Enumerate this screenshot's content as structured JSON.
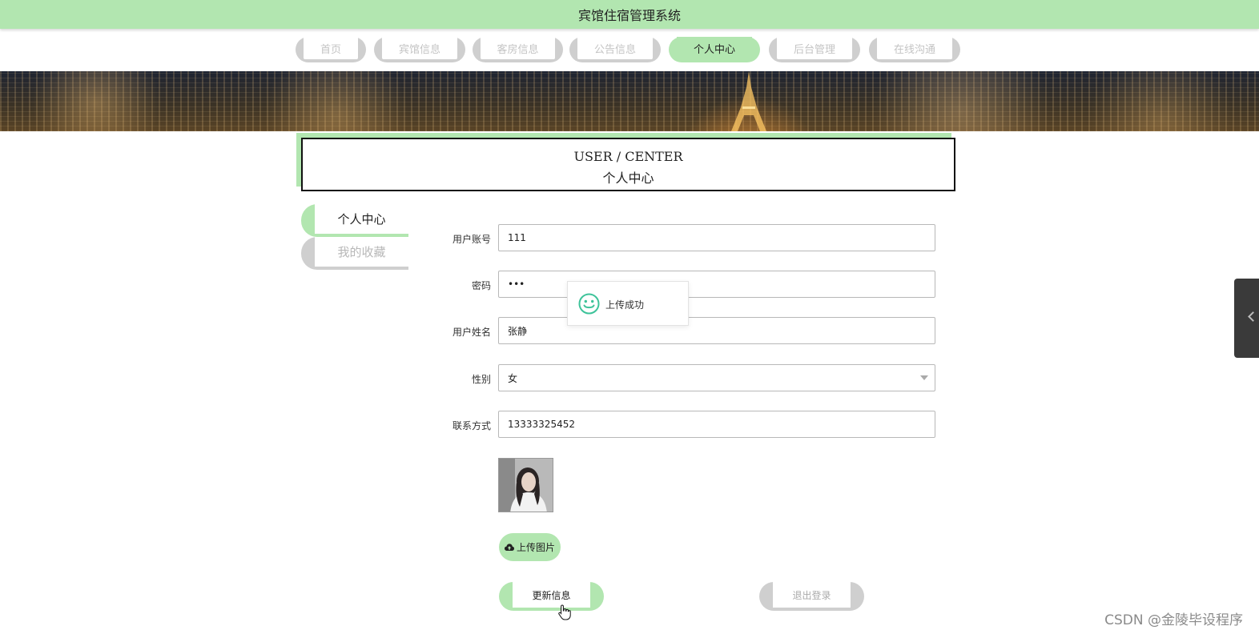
{
  "app": {
    "title": "宾馆住宿管理系统"
  },
  "nav": {
    "items": [
      {
        "label": "首页",
        "active": false
      },
      {
        "label": "宾馆信息",
        "active": false
      },
      {
        "label": "客房信息",
        "active": false
      },
      {
        "label": "公告信息",
        "active": false
      },
      {
        "label": "个人中心",
        "active": true
      },
      {
        "label": "后台管理",
        "active": false
      },
      {
        "label": "在线沟通",
        "active": false
      }
    ]
  },
  "header": {
    "en": "USER / CENTER",
    "cn": "个人中心"
  },
  "sidebar": {
    "items": [
      {
        "label": "个人中心",
        "active": true
      },
      {
        "label": "我的收藏",
        "active": false
      }
    ]
  },
  "form": {
    "account": {
      "label": "用户账号",
      "value": "111"
    },
    "password": {
      "label": "密码",
      "value": "•••"
    },
    "name": {
      "label": "用户姓名",
      "value": "张静"
    },
    "gender": {
      "label": "性别",
      "value": "女"
    },
    "phone": {
      "label": "联系方式",
      "value": "13333325452"
    },
    "upload_label": "上传图片",
    "update_label": "更新信息",
    "logout_label": "退出登录"
  },
  "toast": {
    "message": "上传成功"
  },
  "watermark": "CSDN @金陵毕设程序",
  "colors": {
    "accent": "#b2e6b0",
    "inactive": "#cfcfcf",
    "text": "#222222"
  },
  "icons": {
    "upload": "cloud-upload-icon",
    "toast": "smile-icon",
    "side_tab": "chevron-left-icon"
  }
}
